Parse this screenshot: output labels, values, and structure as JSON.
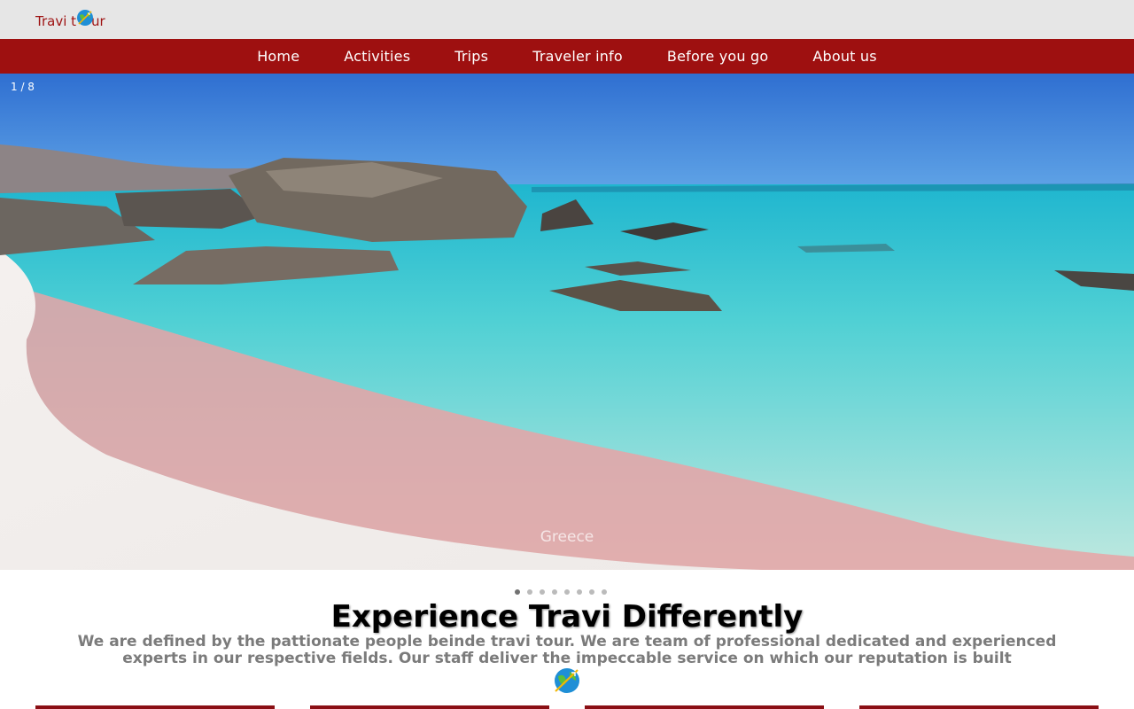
{
  "brand": {
    "name_part1": "Travi t",
    "name_part2": "ur",
    "logo_icon": "globe-airplane-icon",
    "color": "#9e1212"
  },
  "nav": {
    "background": "#9e1010",
    "items": [
      {
        "label": "Home"
      },
      {
        "label": "Activities"
      },
      {
        "label": "Trips"
      },
      {
        "label": "Traveler info"
      },
      {
        "label": "Before you go"
      },
      {
        "label": "About us"
      }
    ]
  },
  "slideshow": {
    "counter": "1 / 8",
    "caption": "Greece",
    "total_slides": 8,
    "active_index": 0
  },
  "main": {
    "headline": "Experience Travi Differently",
    "intro": "We are defined by the pattionate people beinde travi tour. We are team of professional dedicated and experienced experts in our respective fields. Our staff deliver the impeccable service on which our reputation is built",
    "divider_icon": "globe-airplane-icon"
  },
  "cards": {
    "count": 4,
    "accent": "#8a0f14"
  }
}
